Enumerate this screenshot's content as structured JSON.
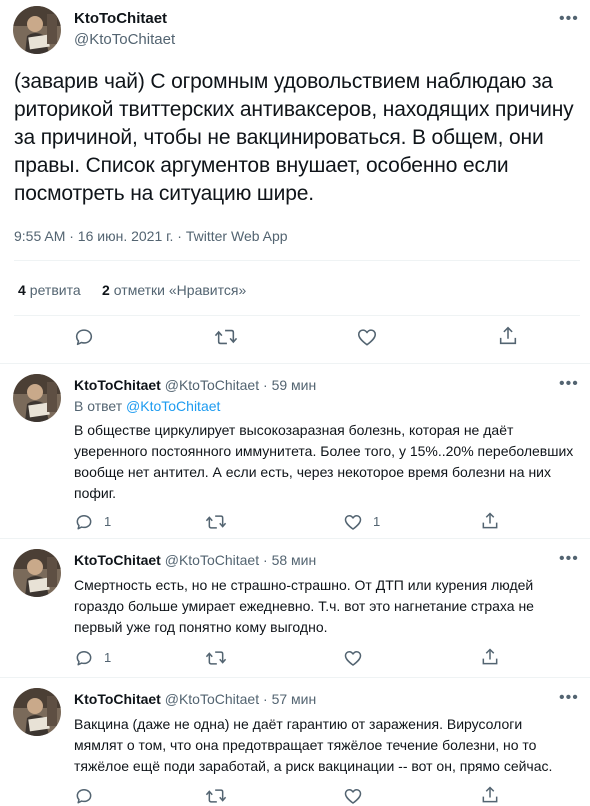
{
  "main_tweet": {
    "display_name": "KtoToChitaet",
    "handle": "@KtoToChitaet",
    "text": "(заварив чай) С огромным удовольствием наблюдаю за риторикой твиттерских антиваксеров, находящих причину за причиной, чтобы не вакцинироваться. В общем, они правы. Список аргументов внушает, особенно если посмотреть на ситуацию шире.",
    "meta": "9:55 AM · 16 июн. 2021 г. · Twitter Web App",
    "retweets_count": "4",
    "retweets_label": "ретвита",
    "likes_count": "2",
    "likes_label": "отметки «Нравится»"
  },
  "replies": [
    {
      "display_name": "KtoToChitaet",
      "handle": "@KtoToChitaet",
      "time": "59 мин",
      "reply_to_prefix": "В ответ",
      "reply_to_handle": "@KtoToChitaet",
      "text": "В обществе циркулирует высокозаразная болезнь, которая не даёт уверенного постоянного иммунитета. Более того, у 15%..20% переболевших вообще нет антител. А если есть, через некоторое время болезни на них пофиг.",
      "reply_count": "1",
      "retweet_count": "",
      "like_count": "1"
    },
    {
      "display_name": "KtoToChitaet",
      "handle": "@KtoToChitaet",
      "time": "58 мин",
      "text": "Смертность есть, но не страшно-страшно. От ДТП или курения людей гораздо больше умирает ежедневно. Т.ч. вот это нагнетание страха не первый уже год понятно кому выгодно.",
      "reply_count": "1",
      "retweet_count": "",
      "like_count": ""
    },
    {
      "display_name": "KtoToChitaet",
      "handle": "@KtoToChitaet",
      "time": "57 мин",
      "text": "Вакцина (даже не одна) не даёт гарантию от заражения. Вирусологи мямлят о том, что она предотвращает тяжёлое течение болезни, но то тяжёлое ещё поди заработай, а риск вакцинации -- вот он, прямо сейчас.",
      "reply_count": "",
      "retweet_count": "",
      "like_count": ""
    }
  ],
  "icons": {
    "avatar": "user-avatar-photo",
    "more": "more-dots-icon",
    "reply": "reply-bubble-icon",
    "retweet": "retweet-arrows-icon",
    "like": "heart-icon",
    "share": "share-upload-icon"
  },
  "colors": {
    "text": "#0f1419",
    "secondary": "#536471",
    "link": "#1d9bf0",
    "divider": "#eff3f4"
  }
}
